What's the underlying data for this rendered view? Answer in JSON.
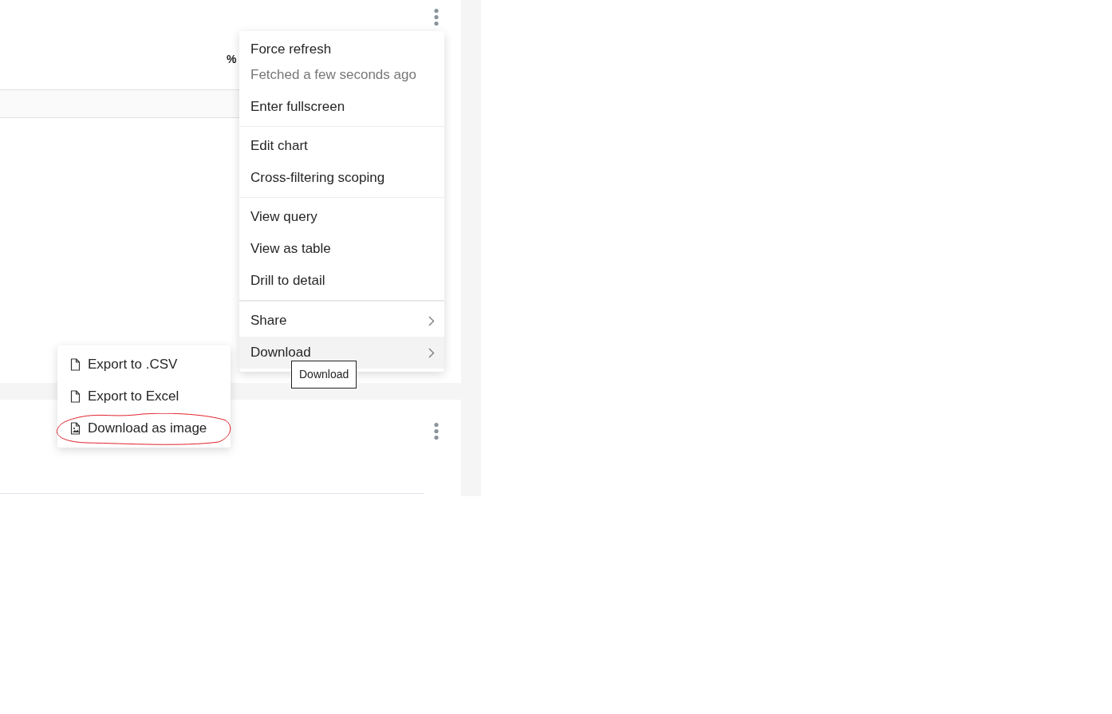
{
  "top_chart": {
    "unit_label": "%"
  },
  "menu": {
    "groups": [
      {
        "items": [
          {
            "kind": "item_with_subtext",
            "label": "Force refresh",
            "subtext": "Fetched a few seconds ago",
            "selected": false
          },
          {
            "kind": "item",
            "label": "Enter fullscreen",
            "selected": false
          }
        ]
      },
      {
        "items": [
          {
            "kind": "item",
            "label": "Edit chart",
            "selected": false
          },
          {
            "kind": "item",
            "label": "Cross-filtering scoping",
            "selected": false
          }
        ]
      },
      {
        "items": [
          {
            "kind": "item",
            "label": "View query",
            "selected": false
          },
          {
            "kind": "item",
            "label": "View as table",
            "selected": false
          },
          {
            "kind": "item",
            "label": "Drill to detail",
            "selected": false
          }
        ]
      },
      {
        "items": [
          {
            "kind": "submenu",
            "label": "Share",
            "selected": false
          },
          {
            "kind": "submenu",
            "label": "Download",
            "selected": true
          }
        ]
      }
    ]
  },
  "submenu": {
    "items": [
      {
        "kind": "file",
        "label": "Export to .CSV",
        "annotated": false
      },
      {
        "kind": "file",
        "label": "Export to Excel",
        "annotated": false
      },
      {
        "kind": "image",
        "label": "Download as image",
        "annotated": true
      }
    ]
  },
  "tooltip": {
    "text": "Download"
  }
}
